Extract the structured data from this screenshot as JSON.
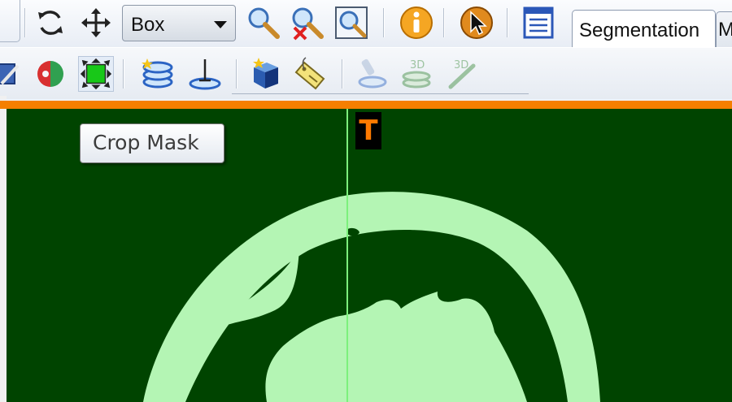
{
  "toolbar_top": {
    "combo": {
      "selected": "Box"
    },
    "tabs": [
      {
        "label": "Segmentation"
      },
      {
        "label": "M"
      }
    ]
  },
  "viewer": {
    "orientation_marker": "T",
    "background_color": "#004400",
    "mask_color": "#b4f5b4",
    "crosshair_color": "#7cf07c"
  },
  "tooltip": {
    "text": "Crop Mask"
  },
  "icons": [
    "rotate-icon",
    "pan-icon",
    "zoom-icon",
    "zoom-reset-icon",
    "zoom-region-icon",
    "info-icon",
    "cursor-icon",
    "list-view-icon",
    "edit-icon",
    "segment-icon",
    "crop-mask-icon",
    "layers-icon",
    "seed-point-icon",
    "mask-cube-icon",
    "tag-icon",
    "3d-paint-icon",
    "3d-layers-icon",
    "3d-brush-icon"
  ]
}
